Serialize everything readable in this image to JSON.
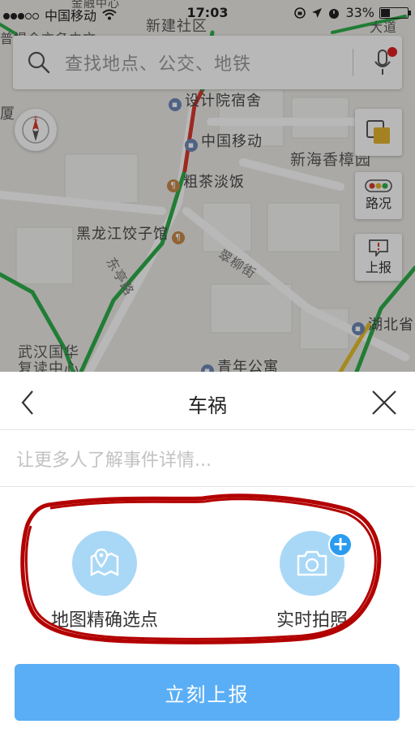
{
  "status_bar": {
    "carrier": "中国移动",
    "time": "17:03",
    "battery_percent_text": "33%",
    "battery_level": 0.33
  },
  "search": {
    "placeholder": "查找地点、公交、地铁",
    "search_icon": "search-icon",
    "mic_icon": "microphone-icon"
  },
  "map": {
    "labels": {
      "xinjian": "新建社区",
      "top_left": "普提今亦名由文",
      "dajin": "大道",
      "xia": "厦",
      "design": "设计院宿舍",
      "mobile": "中国移动",
      "xinhai": "新海香樟园",
      "cuchadanfan": "粗茶淡饭",
      "heilongjiang": "黑龙江饺子馆",
      "cuiliu": "翠柳街",
      "dongting": "东亭路",
      "hubei": "湖北省",
      "wuhan": "武汉国华",
      "fudu": "复读中心",
      "qingnian": "青年公寓",
      "jinrong": "金融中心"
    },
    "compass_icon": "compass-icon",
    "compass_north": "北",
    "buttons": {
      "layers": "layers-icon",
      "traffic": "路况",
      "report": "上报"
    },
    "colors": {
      "traffic_green": "#2fae4a",
      "traffic_red": "#d83a2e",
      "map_bg": "#ecebe7"
    }
  },
  "panel": {
    "title": "车祸",
    "back_icon": "back-chevron-icon",
    "close_icon": "close-icon",
    "detail_placeholder": "让更多人了解事件详情...",
    "actions": [
      {
        "label": "地图精确选点",
        "icon": "map-pin-icon"
      },
      {
        "label": "实时拍照",
        "icon": "camera-icon",
        "badge": "+"
      }
    ],
    "submit_label": "立刻上报",
    "colors": {
      "accent": "#5aaef5",
      "circle": "#a9d8f7",
      "badge": "#2b9bf0",
      "annotation": "#b30000"
    }
  }
}
